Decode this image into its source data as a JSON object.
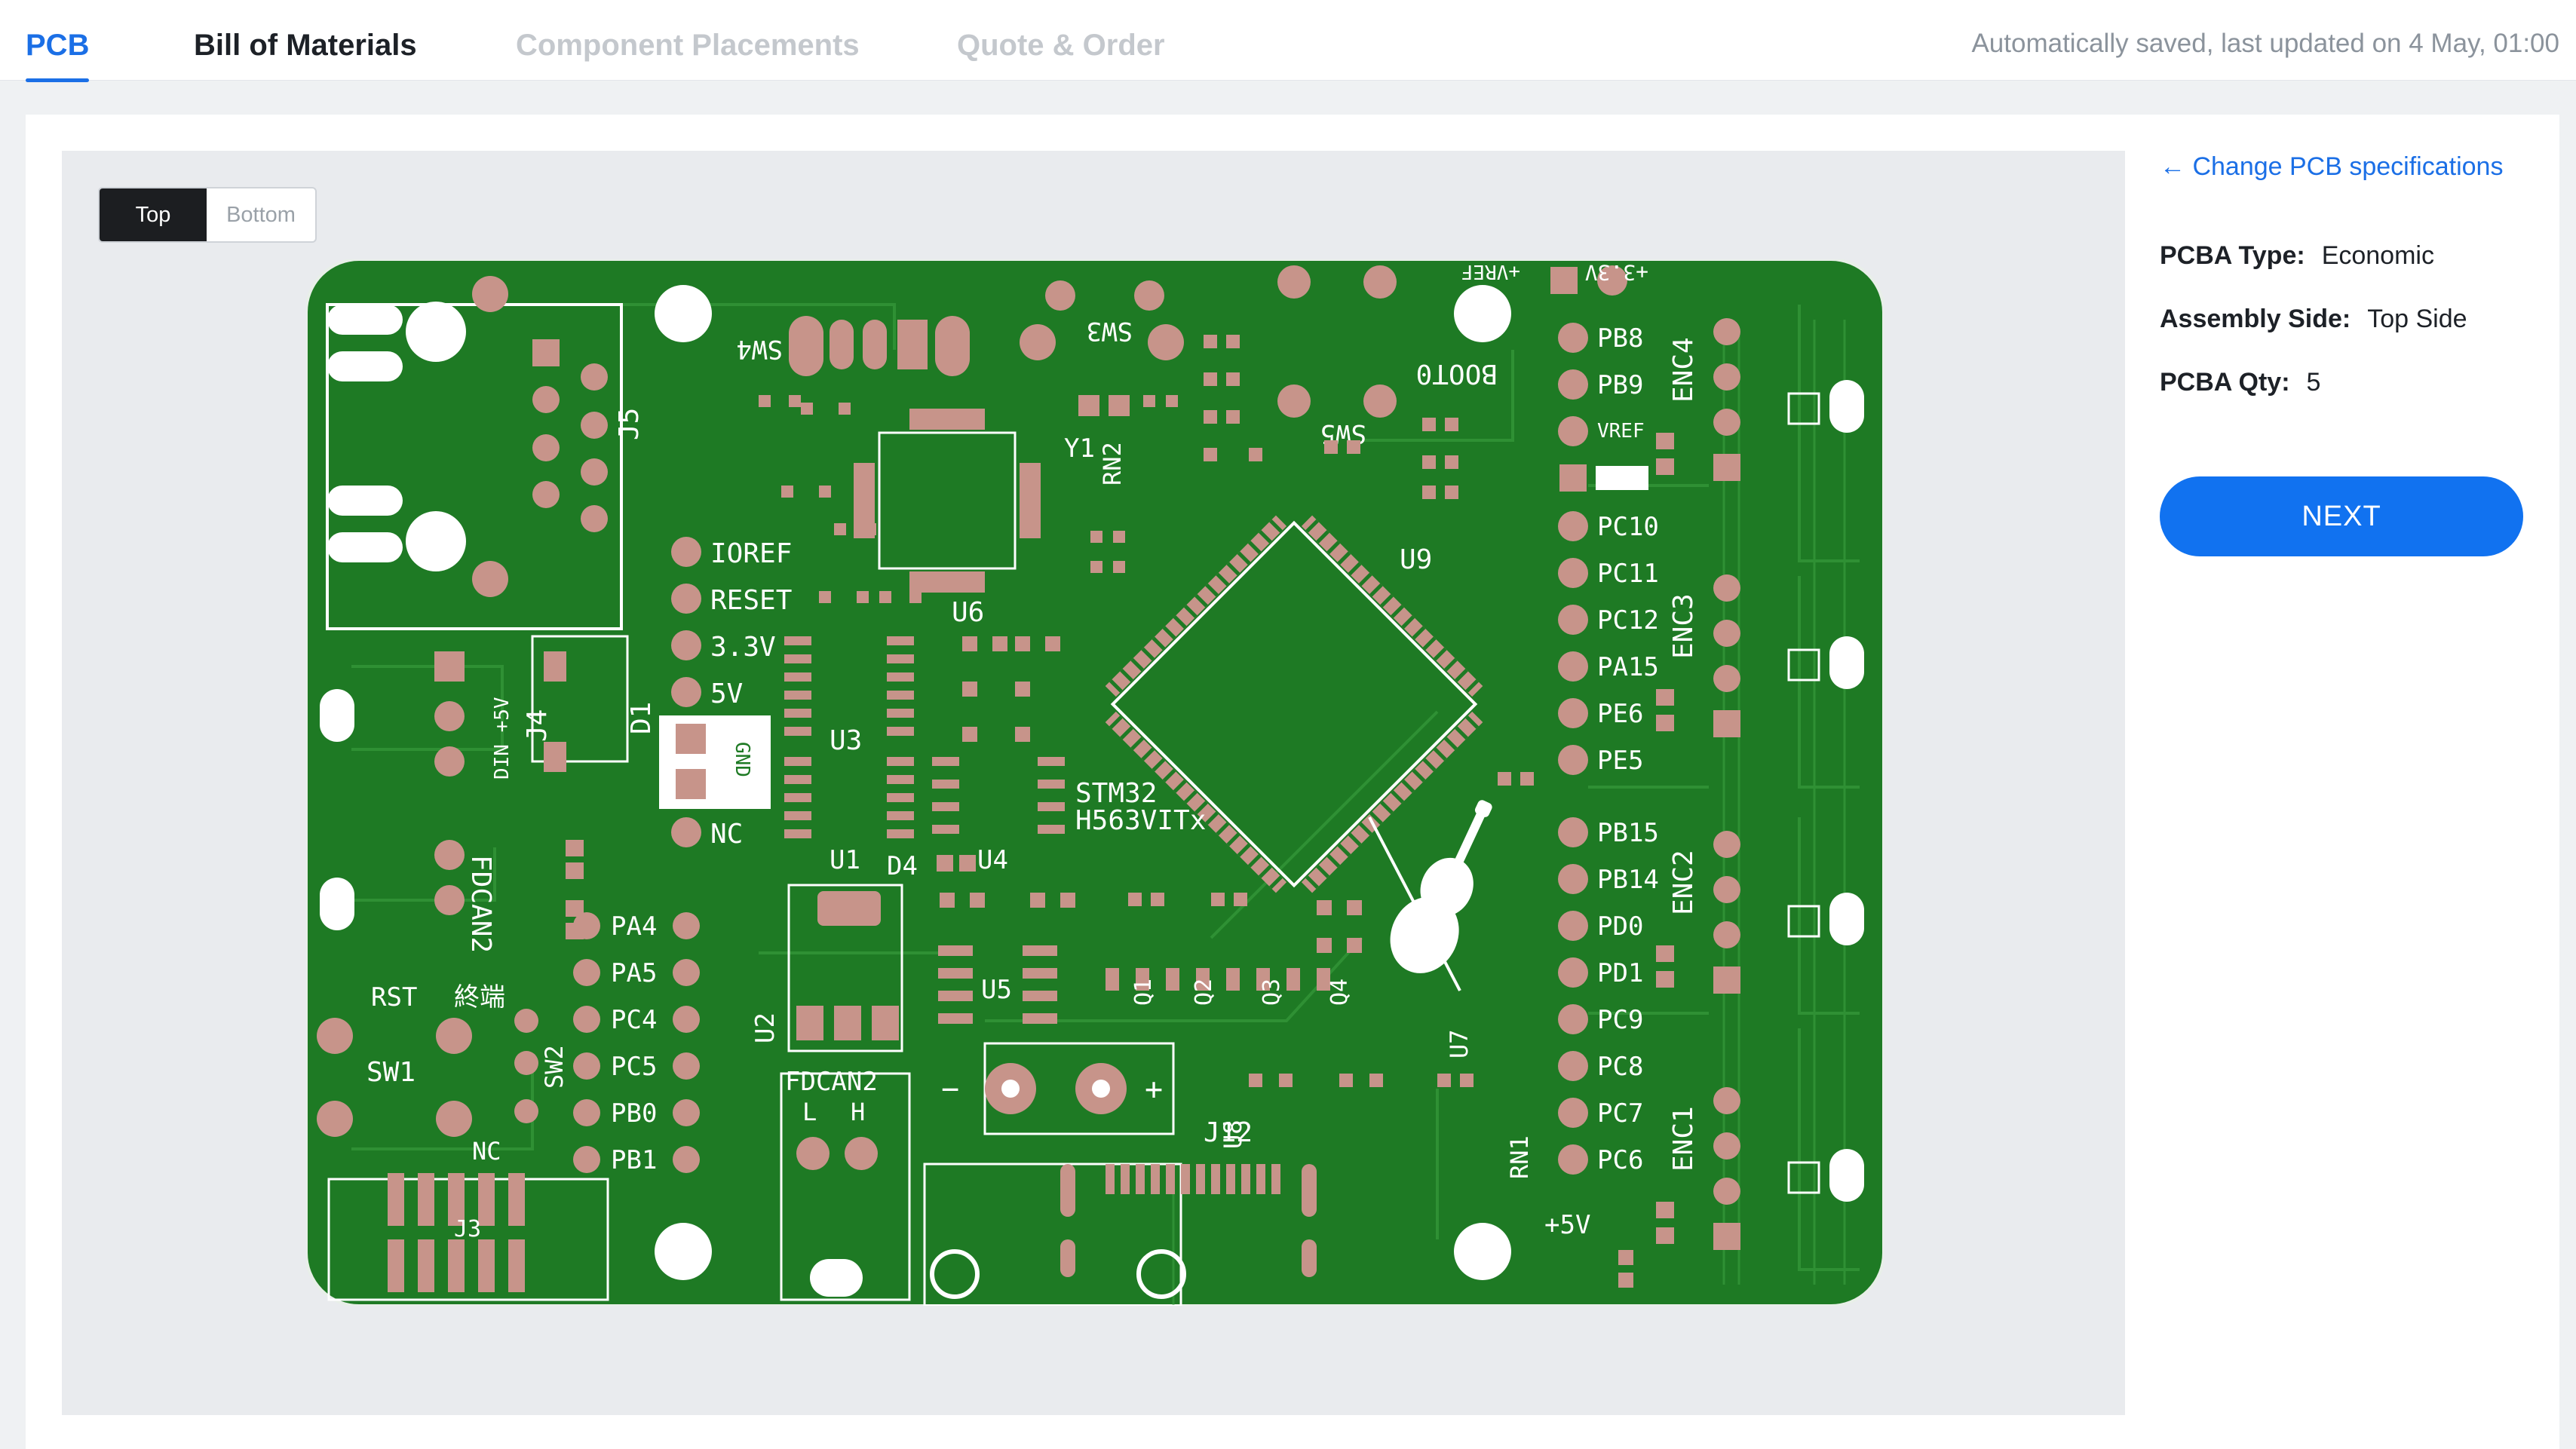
{
  "tabs": {
    "pcb": "PCB",
    "bom": "Bill of Materials",
    "placements": "Component Placements",
    "quote": "Quote & Order"
  },
  "autosave": "Automatically saved, last updated on 4 May, 01:00",
  "viewer": {
    "side_top": "Top",
    "side_bottom": "Bottom",
    "active_side": "Top"
  },
  "board_labels": {
    "pins_left": [
      "IOREF",
      "RESET",
      "3.3V",
      "5V",
      "NC"
    ],
    "gnd": "GND",
    "designators": {
      "j5": "J5",
      "j4": "J4",
      "d1": "D1",
      "din": "DIN +5V",
      "sw4": "SW4",
      "sw3": "SW3",
      "sw5": "SW5",
      "u6": "U6",
      "u3": "U3",
      "u1": "U1",
      "d4": "D4",
      "u4": "U4",
      "y1": "Y1",
      "rn2": "RN2",
      "u9": "U9",
      "boot0": "BOOT0",
      "mcu": [
        "STM32",
        "H563VITx"
      ],
      "fdcan2_side": "FDCAN2",
      "rst": "RST",
      "sw1": "SW1",
      "sw2": "SW2",
      "tail": "終端",
      "nc": "NC",
      "j3": "J3",
      "u2": "U2",
      "u5": "U5",
      "fdcan2": "FDCAN2",
      "can_l": "L",
      "can_h": "H",
      "minus": "−",
      "plus": "+",
      "u8": "U8",
      "j12": "J12",
      "u7": "U7",
      "rn1": "RN1",
      "q1": "Q1",
      "q2": "Q2",
      "q3": "Q3",
      "q4": "Q4"
    },
    "pins_mid": [
      "PA4",
      "PA5",
      "PC4",
      "PC5",
      "PB0",
      "PB1"
    ],
    "pins_right": [
      "PB8",
      "PB9",
      "VREF",
      "",
      "PC10",
      "PC11",
      "PC12",
      "PA15",
      "PE6",
      "PE5",
      "PB15",
      "PB14",
      "PD0",
      "PD1",
      "PC9",
      "PC8",
      "PC7",
      "PC6"
    ],
    "enc": [
      "ENC4",
      "ENC3",
      "ENC2",
      "ENC1"
    ],
    "power": {
      "p33": "+3.3V",
      "p5": "+5V",
      "vref": "+VREF"
    }
  },
  "spec": {
    "change_link": "← Change PCB specifications",
    "type_label": "PCBA Type:",
    "type_value": "Economic",
    "side_label": "Assembly Side:",
    "side_value": "Top Side",
    "qty_label": "PCBA Qty:",
    "qty_value": "5"
  },
  "next_label": "NEXT",
  "colors": {
    "accent": "#1172f0",
    "pcb_green": "#1e7a24",
    "pad": "#c7948a",
    "silk": "#ffffff"
  }
}
